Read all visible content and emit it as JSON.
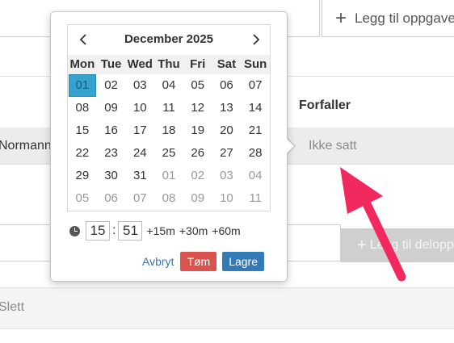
{
  "toolbar": {
    "add_task_label": "Legg til oppgave"
  },
  "table": {
    "due_header": "Forfaller",
    "row": {
      "name": "Normann",
      "due": "Ikke satt"
    }
  },
  "subtask": {
    "add_label": "Legg til deloppgave"
  },
  "delete_label": "Slett",
  "picker": {
    "month_title": "December 2025",
    "weekdays": [
      "Mon",
      "Tue",
      "Wed",
      "Thu",
      "Fri",
      "Sat",
      "Sun"
    ],
    "days": [
      {
        "d": "01",
        "muted": false,
        "selected": true
      },
      {
        "d": "02",
        "muted": false
      },
      {
        "d": "03",
        "muted": false
      },
      {
        "d": "04",
        "muted": false
      },
      {
        "d": "05",
        "muted": false
      },
      {
        "d": "06",
        "muted": false
      },
      {
        "d": "07",
        "muted": false
      },
      {
        "d": "08",
        "muted": false
      },
      {
        "d": "09",
        "muted": false
      },
      {
        "d": "10",
        "muted": false
      },
      {
        "d": "11",
        "muted": false
      },
      {
        "d": "12",
        "muted": false
      },
      {
        "d": "13",
        "muted": false
      },
      {
        "d": "14",
        "muted": false
      },
      {
        "d": "15",
        "muted": false
      },
      {
        "d": "16",
        "muted": false
      },
      {
        "d": "17",
        "muted": false
      },
      {
        "d": "18",
        "muted": false
      },
      {
        "d": "19",
        "muted": false
      },
      {
        "d": "20",
        "muted": false
      },
      {
        "d": "21",
        "muted": false
      },
      {
        "d": "22",
        "muted": false
      },
      {
        "d": "23",
        "muted": false
      },
      {
        "d": "24",
        "muted": false
      },
      {
        "d": "25",
        "muted": false
      },
      {
        "d": "26",
        "muted": false
      },
      {
        "d": "27",
        "muted": false
      },
      {
        "d": "28",
        "muted": false
      },
      {
        "d": "29",
        "muted": false
      },
      {
        "d": "30",
        "muted": false
      },
      {
        "d": "31",
        "muted": false
      },
      {
        "d": "01",
        "muted": true
      },
      {
        "d": "02",
        "muted": true
      },
      {
        "d": "03",
        "muted": true
      },
      {
        "d": "04",
        "muted": true
      },
      {
        "d": "05",
        "muted": true
      },
      {
        "d": "06",
        "muted": true
      },
      {
        "d": "07",
        "muted": true
      },
      {
        "d": "08",
        "muted": true
      },
      {
        "d": "09",
        "muted": true
      },
      {
        "d": "10",
        "muted": true
      },
      {
        "d": "11",
        "muted": true
      }
    ],
    "time": {
      "hour": "15",
      "minute": "51",
      "separator": ":"
    },
    "quick_adds": [
      "+15m",
      "+30m",
      "+60m"
    ],
    "cancel_label": "Avbryt",
    "clear_label": "Tøm",
    "save_label": "Lagre",
    "icons": {
      "prev": "chevron-left-icon",
      "next": "chevron-right-icon",
      "clock": "clock-icon"
    }
  },
  "colors": {
    "selected_day": "#35a3d0",
    "danger": "#d9534f",
    "primary": "#337ab7",
    "annotation_arrow": "#f2295e"
  }
}
